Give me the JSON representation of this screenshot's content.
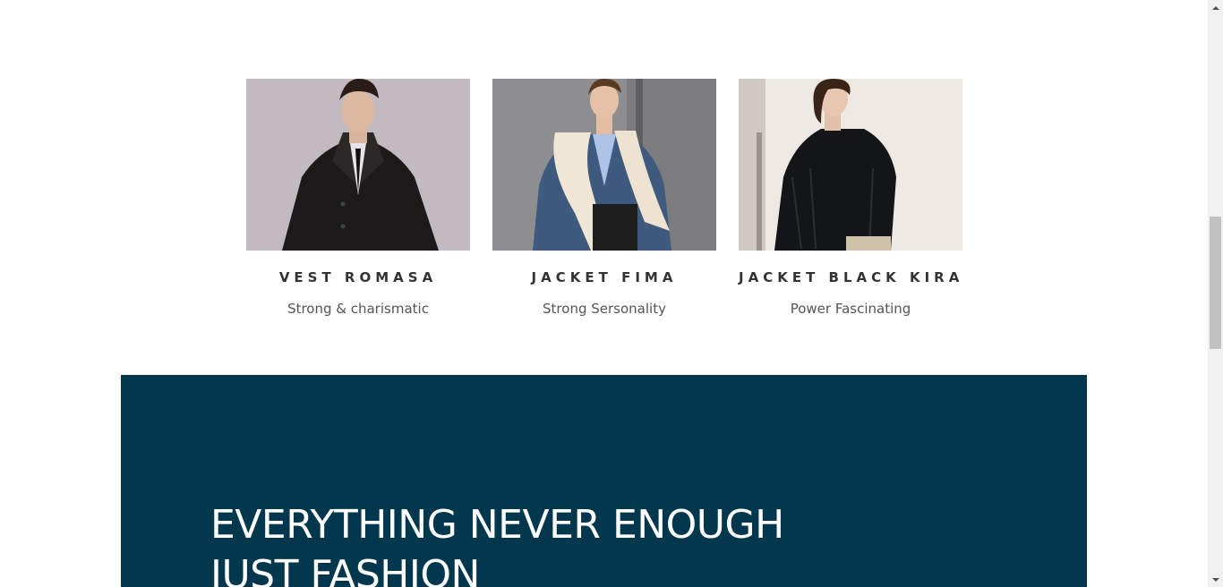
{
  "products": [
    {
      "title": "VEST ROMASA",
      "subtitle": "Strong & charismatic",
      "image": "man-black-coat-photo"
    },
    {
      "title": "JACKET FIMA",
      "subtitle": "Strong Sersonality",
      "image": "woman-fur-collar-denim-jacket-photo"
    },
    {
      "title": "JACKET BLACK KIRA",
      "subtitle": "Power Fascinating",
      "image": "woman-black-leather-jacket-photo"
    }
  ],
  "banner": {
    "line1": "EVERYTHING NEVER ENOUGH",
    "line2": "JUST FASHION",
    "background": "#03374d"
  },
  "colors": {
    "title_text": "#333333",
    "subtitle_text": "#555555",
    "banner_text": "#ffffff"
  }
}
